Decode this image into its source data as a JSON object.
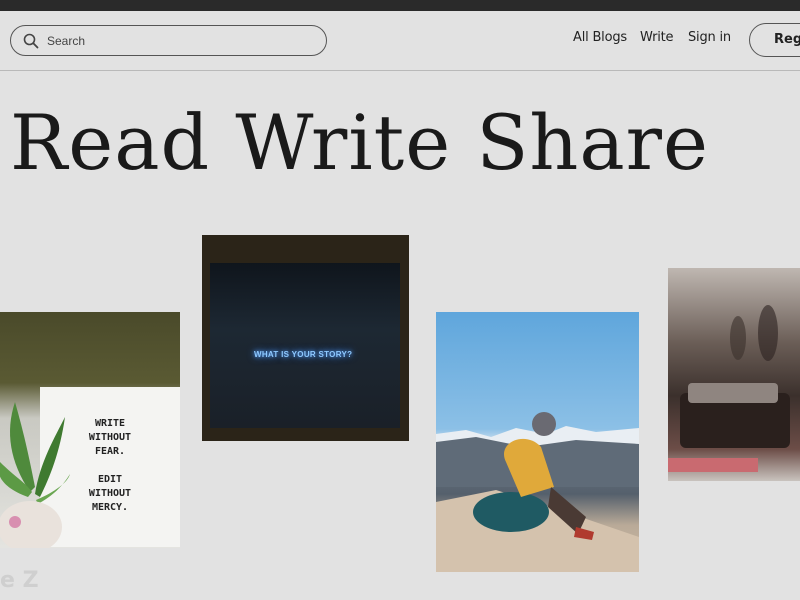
{
  "header": {
    "search_placeholder": "Search",
    "nav_links": [
      "All Blogs",
      "Write",
      "Sign in"
    ],
    "register_label": "Regi"
  },
  "hero": {
    "title": "Read Write Share"
  },
  "cards": {
    "sign_lines": [
      "WRITE",
      "WITHOUT",
      "FEAR.",
      "",
      "EDIT",
      "WITHOUT",
      "MERCY."
    ],
    "neon_text": "WHAT IS YOUR STORY?"
  },
  "footer": {
    "watermark": "e Z"
  },
  "colors": {
    "background": "#e2e2e2",
    "topbar": "#2a2a2a",
    "text": "#1b1b1b",
    "neon": "#8ec9ff"
  }
}
